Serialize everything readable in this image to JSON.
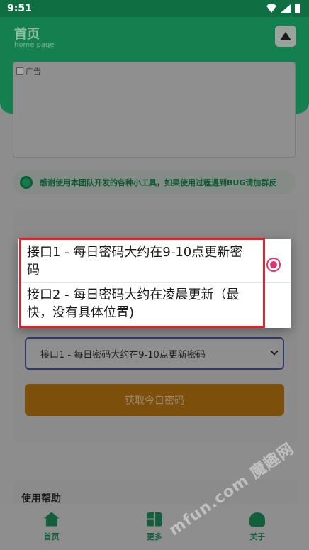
{
  "status_bar": {
    "time": "9:51"
  },
  "header": {
    "title": "首页",
    "subtitle": "home page"
  },
  "ad": {
    "label": "广告"
  },
  "notice": {
    "text": "感谢使用本团队开发的各种小工具，如果使用过程遇到BUG请加群反"
  },
  "api_select": {
    "value": "接口1 - 每日密码大约在9-10点更新密码"
  },
  "get_button": {
    "label": "获取今日密码"
  },
  "help": {
    "title": "使用帮助"
  },
  "dialog": {
    "options": [
      {
        "label": "接口1 - 每日密码大约在9-10点更新密码",
        "selected": true
      },
      {
        "label": "接口2 - 每日密码大约在凌晨更新（最快，没有具体位置)",
        "selected": false
      }
    ],
    "accent_color": "#e0356a"
  },
  "bottom_nav": {
    "items": [
      {
        "label": "首页",
        "icon": "home-icon"
      },
      {
        "label": "更多",
        "icon": "apps-icon"
      },
      {
        "label": "关于",
        "icon": "user-icon"
      }
    ]
  },
  "watermark": {
    "text": "mfun.com 魔趣网"
  },
  "colors": {
    "brand_green": "#1a9a5e",
    "button_orange": "#c27a10",
    "highlight_red": "#e0202a"
  }
}
